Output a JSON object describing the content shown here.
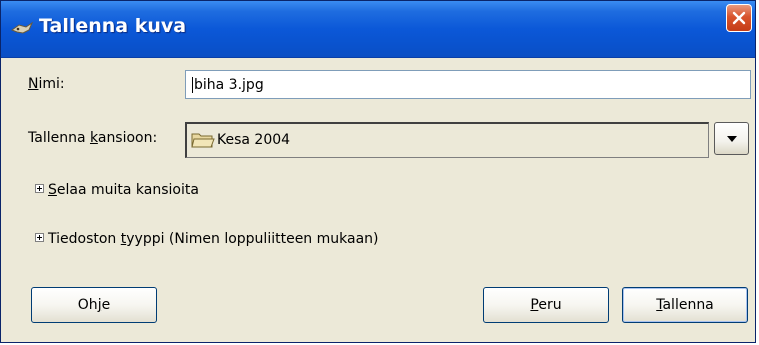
{
  "window": {
    "title": "Tallenna kuva",
    "close_icon": "close-icon"
  },
  "form": {
    "name_label_prefix": "",
    "name_label_accel": "N",
    "name_label_rest": "imi:",
    "name_value": "biha 3.jpg",
    "folder_label_prefix": "Tallenna ",
    "folder_label_accel": "k",
    "folder_label_rest": "ansioon:",
    "folder_value": "Kesa 2004",
    "folder_icon": "folder-icon",
    "dropdown_icon": "chevron-down-icon"
  },
  "expanders": {
    "browse_prefix": "",
    "browse_accel": "S",
    "browse_rest": "elaa muita kansioita",
    "type_prefix": "Tiedoston ",
    "type_accel": "t",
    "type_rest": "yyppi (Nimen loppuliitteen mukaan)"
  },
  "buttons": {
    "help_prefix": "Oh",
    "help_accel": "j",
    "help_rest": "e",
    "cancel_prefix": "",
    "cancel_accel": "P",
    "cancel_rest": "eru",
    "save_prefix": "",
    "save_accel": "T",
    "save_rest": "allenna"
  },
  "colors": {
    "titlebar": "#0a52cd",
    "dialog_bg": "#ece9d8",
    "close_button": "#d9542c"
  }
}
